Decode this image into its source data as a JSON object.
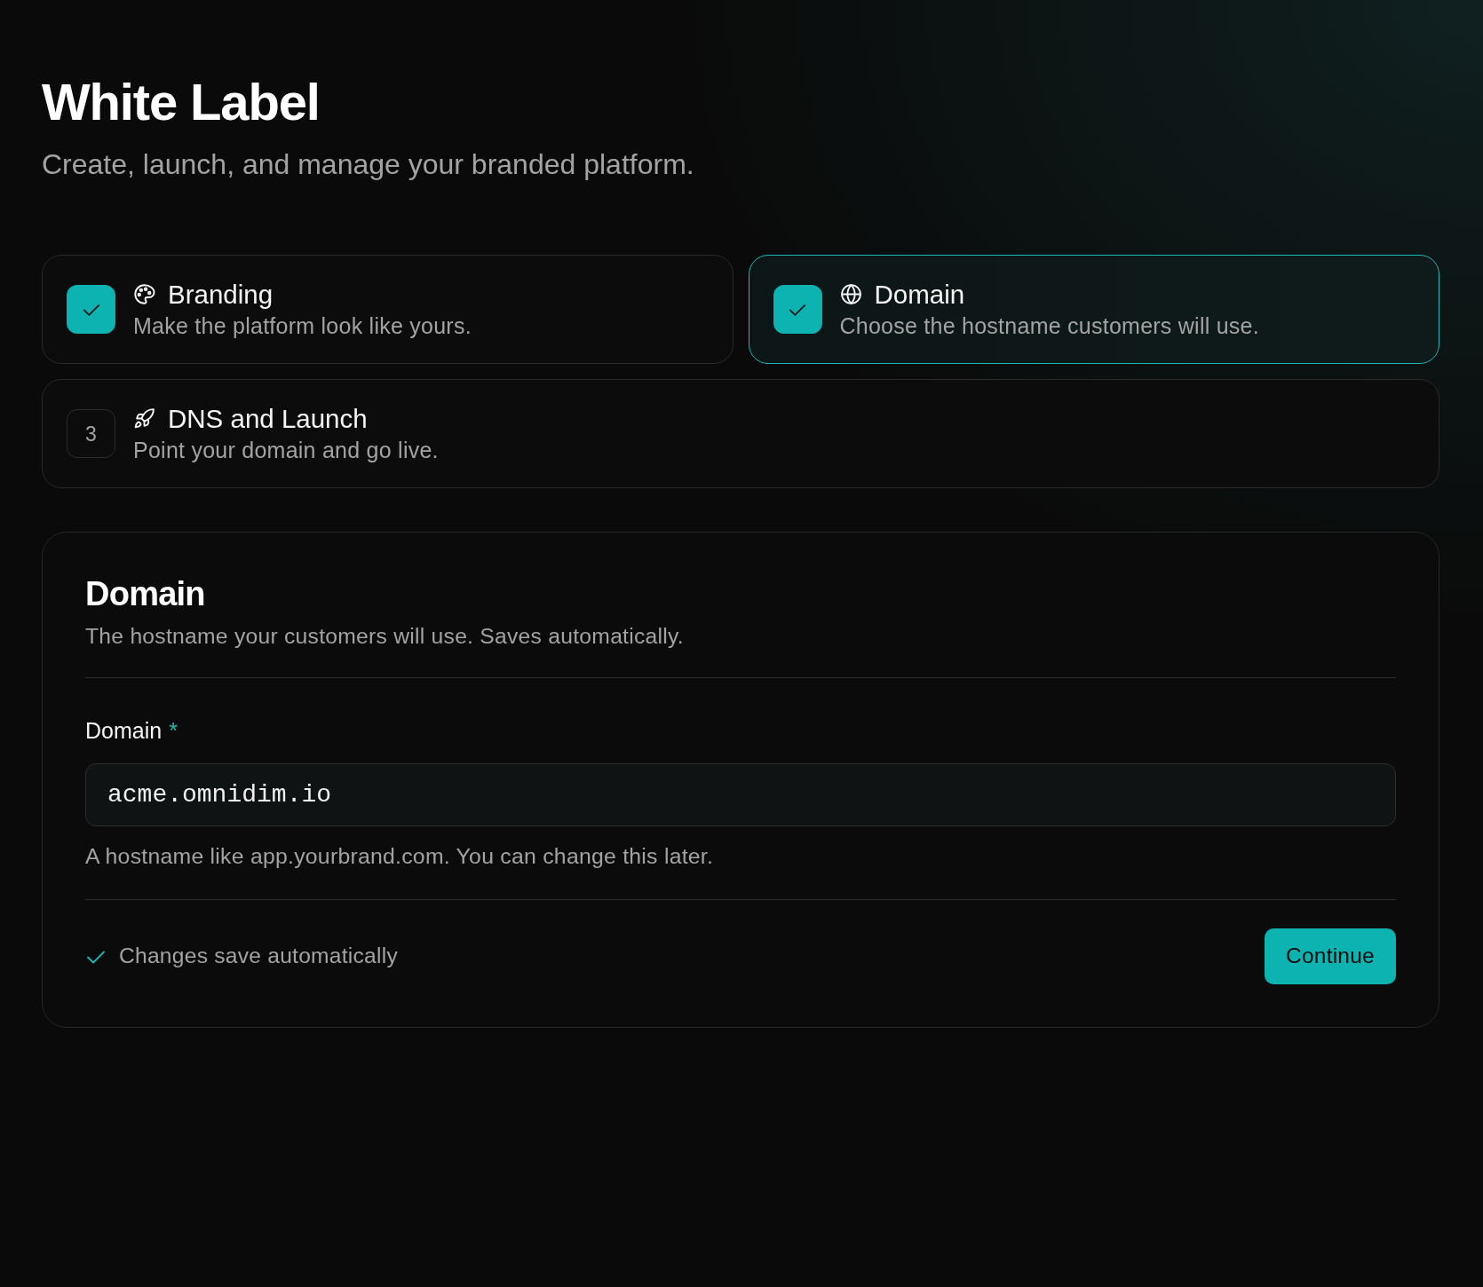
{
  "header": {
    "title": "White Label",
    "subtitle": "Create, launch, and manage your branded platform."
  },
  "steps": [
    {
      "title": "Branding",
      "description": "Make the platform look like yours.",
      "completed": true,
      "selected": false
    },
    {
      "title": "Domain",
      "description": "Choose the hostname customers will use.",
      "completed": true,
      "selected": true
    },
    {
      "title": "DNS and Launch",
      "description": "Point your domain and go live.",
      "number": "3",
      "completed": false,
      "selected": false
    }
  ],
  "form": {
    "title": "Domain",
    "description": "The hostname your customers will use. Saves automatically.",
    "field": {
      "label": "Domain",
      "required_mark": "*",
      "value": "acme.omnidim.io",
      "help": "A hostname like app.yourbrand.com. You can change this later."
    },
    "footer": {
      "status": "Changes save automatically",
      "button": "Continue"
    }
  }
}
